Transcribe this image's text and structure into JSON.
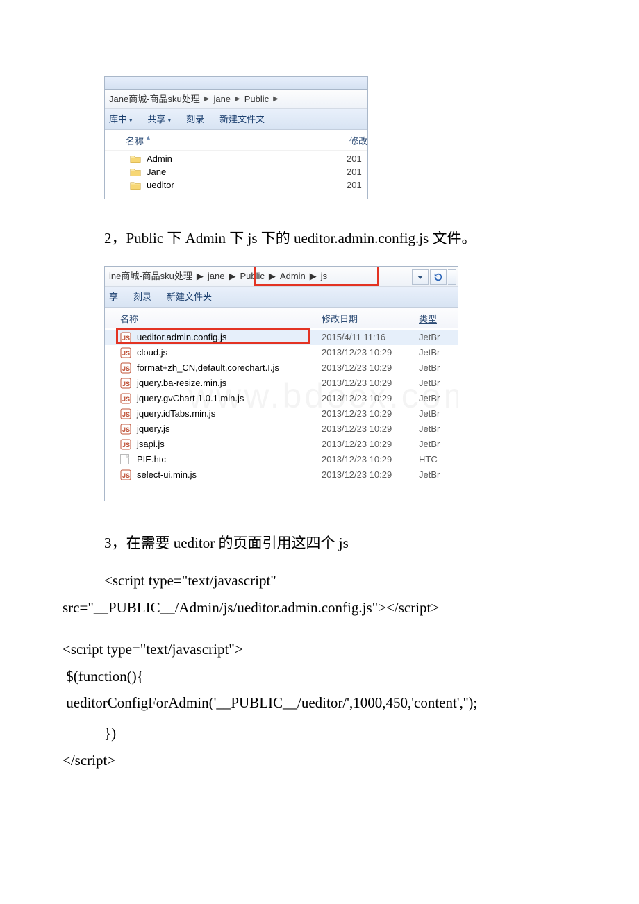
{
  "explorer1": {
    "breadcrumb": [
      "Jane商城-商品sku处理",
      "jane",
      "Public"
    ],
    "toolbar": {
      "lib": "库中",
      "share": "共享",
      "burn": "刻录",
      "newfolder": "新建文件夹"
    },
    "columns": {
      "name": "名称",
      "mod": "修改"
    },
    "rows": [
      {
        "name": "Admin",
        "date": "201"
      },
      {
        "name": "Jane",
        "date": "201"
      },
      {
        "name": "ueditor",
        "date": "201"
      }
    ]
  },
  "para1": "2，Public 下 Admin 下 js 下的 ueditor.admin.config.js 文件。",
  "explorer2": {
    "breadcrumb": [
      "ine商城-商品sku处理",
      "jane",
      "Public",
      "Admin",
      "js"
    ],
    "toolbar": {
      "share": "享",
      "burn": "刻录",
      "newfolder": "新建文件夹"
    },
    "columns": {
      "name": "名称",
      "mod": "修改日期",
      "type": "类型"
    },
    "rows": [
      {
        "icon": "js",
        "name": "ueditor.admin.config.js",
        "date": "2015/4/11 11:16",
        "type": "JetBr",
        "sel": true
      },
      {
        "icon": "js",
        "name": "cloud.js",
        "date": "2013/12/23 10:29",
        "type": "JetBr"
      },
      {
        "icon": "js",
        "name": "format+zh_CN,default,corechart.I.js",
        "date": "2013/12/23 10:29",
        "type": "JetBr"
      },
      {
        "icon": "js",
        "name": "jquery.ba-resize.min.js",
        "date": "2013/12/23 10:29",
        "type": "JetBr"
      },
      {
        "icon": "js",
        "name": "jquery.gvChart-1.0.1.min.js",
        "date": "2013/12/23 10:29",
        "type": "JetBr"
      },
      {
        "icon": "js",
        "name": "jquery.idTabs.min.js",
        "date": "2013/12/23 10:29",
        "type": "JetBr"
      },
      {
        "icon": "js",
        "name": "jquery.js",
        "date": "2013/12/23 10:29",
        "type": "JetBr"
      },
      {
        "icon": "js",
        "name": "jsapi.js",
        "date": "2013/12/23 10:29",
        "type": "JetBr"
      },
      {
        "icon": "htc",
        "name": "PIE.htc",
        "date": "2013/12/23 10:29",
        "type": "HTC"
      },
      {
        "icon": "js",
        "name": "select-ui.min.js",
        "date": "2013/12/23 10:29",
        "type": "JetBr"
      }
    ]
  },
  "para2": "3，在需要 ueditor 的页面引用这四个 js",
  "code1_a": "<script type=\"text/javascript\"",
  "code1_b": "src=\"__PUBLIC__/Admin/js/ueditor.admin.config.js\"></script>",
  "code2_a": "<script type=\"text/javascript\">",
  "code2_b": " $(function(){",
  "code2_c": " ueditorConfigForAdmin('__PUBLIC__/ueditor/',1000,450,'content','');",
  "code3_a": "})",
  "code3_b": "</script>",
  "watermark": "www.bdocx.com"
}
